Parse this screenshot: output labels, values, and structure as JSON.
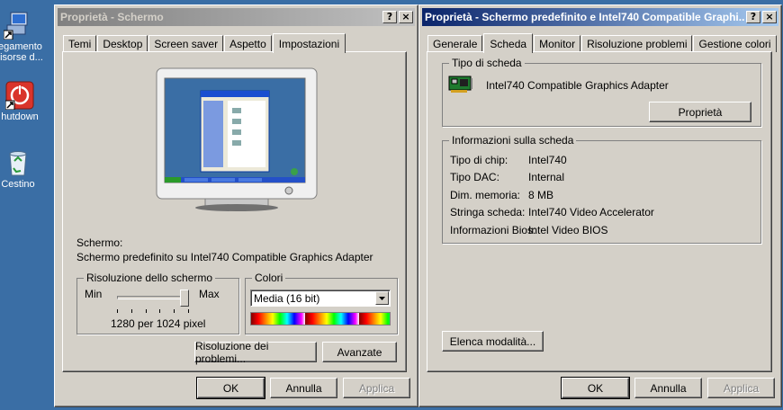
{
  "desktop": {
    "icons": [
      {
        "label1": "llegamento",
        "label2": "Risorse d..."
      },
      {
        "label1": "hutdown",
        "label2": ""
      },
      {
        "label1": "Cestino",
        "label2": ""
      }
    ]
  },
  "win1": {
    "title": "Proprietà - Schermo",
    "help": "?",
    "close": "×",
    "tabs": [
      "Temi",
      "Desktop",
      "Screen saver",
      "Aspetto",
      "Impostazioni"
    ],
    "selected_tab": "Impostazioni",
    "display_caption": "Schermo:",
    "display_value": "Schermo predefinito su Intel740 Compatible Graphics Adapter",
    "resolution": {
      "title": "Risoluzione dello schermo",
      "min": "Min",
      "max": "Max",
      "value_text": "1280 per 1024 pixel",
      "level": 1.0
    },
    "colors": {
      "title": "Colori",
      "selected": "Media (16 bit)"
    },
    "troubleshoot_btn": "Risoluzione dei problemi...",
    "advanced_btn": "Avanzate",
    "ok": "OK",
    "cancel": "Annulla",
    "apply": "Applica",
    "preview": {
      "start": "start"
    }
  },
  "win2": {
    "title": "Proprietà - Schermo predefinito e Intel740 Compatible Graphi...",
    "help": "?",
    "close": "×",
    "tabs": [
      "Generale",
      "Scheda",
      "Monitor",
      "Risoluzione problemi",
      "Gestione colori"
    ],
    "selected_tab": "Scheda",
    "adapter_type_title": "Tipo di scheda",
    "adapter_name": "Intel740 Compatible Graphics Adapter",
    "properties_btn": "Proprietà",
    "info_title": "Informazioni sulla scheda",
    "info": [
      {
        "label": "Tipo di chip:",
        "value": "Intel740"
      },
      {
        "label": "Tipo DAC:",
        "value": "Internal"
      },
      {
        "label": "Dim. memoria:",
        "value": "8 MB"
      },
      {
        "label": "Stringa scheda:",
        "value": "Intel740 Video Accelerator"
      },
      {
        "label": "Informazioni Bios:",
        "value": "Intel Video BIOS"
      }
    ],
    "list_modes_btn": "Elenca modalità...",
    "ok": "OK",
    "cancel": "Annulla",
    "apply": "Applica"
  },
  "colors": {
    "desktop": "#3a6ea5",
    "face": "#d4d0c8",
    "active_title": "#0a246a",
    "inactive_title": "#808080"
  }
}
